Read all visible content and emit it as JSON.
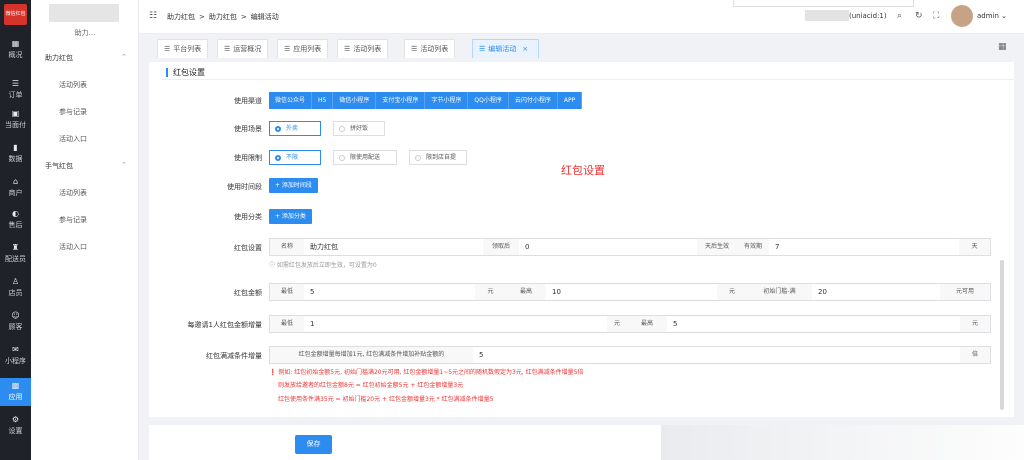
{
  "nav": {
    "logo": "微信红包",
    "items": [
      {
        "label": "概况",
        "icon": "▦"
      },
      {
        "label": "订单",
        "icon": "☰"
      },
      {
        "label": "当面付",
        "icon": "▣"
      },
      {
        "label": "数据",
        "icon": "▮"
      },
      {
        "label": "商户",
        "icon": "⌂"
      },
      {
        "label": "售后",
        "icon": "◐"
      },
      {
        "label": "配送员",
        "icon": "♜"
      },
      {
        "label": "店员",
        "icon": "♙"
      },
      {
        "label": "顾客",
        "icon": "☺"
      },
      {
        "label": "小程序",
        "icon": "✉"
      },
      {
        "label": "应用",
        "icon": "▩"
      },
      {
        "label": "设置",
        "icon": "⚙"
      }
    ]
  },
  "sub": {
    "shop": "助力...",
    "groups": [
      {
        "title": "助力红包",
        "links": [
          "活动列表",
          "参与记录",
          "活动入口"
        ]
      },
      {
        "title": "手气红包",
        "links": [
          "活动列表",
          "参与记录",
          "活动入口"
        ]
      }
    ]
  },
  "header": {
    "breadcrumb": [
      "助力红包",
      ">",
      "助力红包",
      ">",
      "编辑活动"
    ],
    "uniacid": "(uniacid:1)",
    "user": "admin"
  },
  "tabs": [
    {
      "label": "平台列表"
    },
    {
      "label": "运营概况"
    },
    {
      "label": "应用列表"
    },
    {
      "label": "活动列表"
    },
    {
      "label": "活动列表"
    },
    {
      "label": "编辑活动",
      "close": "×"
    }
  ],
  "form": {
    "section": "红包设置",
    "channel_label": "使用渠道",
    "channels": [
      "微信公众号",
      "H5",
      "微信小程序",
      "支付宝小程序",
      "字节小程序",
      "QQ小程序",
      "云闪付小程序",
      "APP"
    ],
    "scene_label": "使用场景",
    "scene_opts": [
      "外卖",
      "拼好饭"
    ],
    "limit_label": "使用限制",
    "limit_opts": [
      "不限",
      "限使用配送",
      "限到店自提"
    ],
    "time_label": "使用时间段",
    "time_btn": "+ 添加时间段",
    "cat_label": "使用分类",
    "cat_btn": "+ 添加分类",
    "hint": "红包设置",
    "pkg_label": "红包设置",
    "name_pre": "名称",
    "name_val": "助力红包",
    "after_pre": "领取后",
    "after_val": "0",
    "days_suf": "天后生效",
    "valid_pre": "有效期",
    "valid_val": "7",
    "valid_suf": "天",
    "tip": "ⓘ 如需红包发放后立即生效，可设置为0",
    "amt_label": "红包金额",
    "min_pre": "最低",
    "min_val": "5",
    "yuan": "元",
    "max_pre": "最高",
    "max_val": "10",
    "thr_pre": "初始门槛-满",
    "thr_val": "20",
    "thr_suf": "元可用",
    "inc_label": "每邀请1人红包金额增量",
    "inc_min": "1",
    "inc_max": "5",
    "cond_label": "红包满减条件增量",
    "cond_pre": "红包金额增量每增加1元, 红包满减条件增加补贴金额的",
    "cond_val": "5",
    "cond_suf": "倍",
    "warn": [
      "❗ 例如: 红包初始金额5元, 初始门槛满20元可用, 红包金额增量1~5元之间的随机数假定为3元, 红包满减条件增量5倍",
      "则发放给邀者的红包金额8元 = 红包初始金额5元 + 红包金额增量3元",
      "红包使用条件满35元 = 初始门槛20元 + 红包金额增量3元 * 红包满减条件增量5"
    ],
    "save": "保存"
  }
}
